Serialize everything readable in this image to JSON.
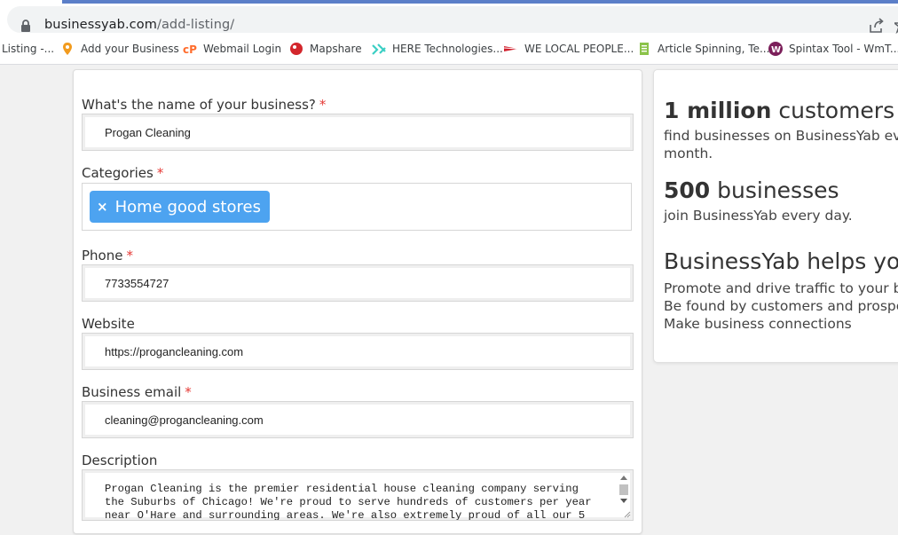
{
  "browser": {
    "url_domain": "businessyab.com",
    "url_path": "/add-listing/",
    "bookmarks": [
      {
        "label": "Listing -...",
        "icon": "none"
      },
      {
        "label": "Add your Business",
        "icon": "location-pin-icon"
      },
      {
        "label": "Webmail Login",
        "icon": "cpanel-icon"
      },
      {
        "label": "Mapshare",
        "icon": "mapshare-icon"
      },
      {
        "label": "HERE Technologies...",
        "icon": "here-icon"
      },
      {
        "label": "WE LOCAL PEOPLE...",
        "icon": "flag-icon"
      },
      {
        "label": "Article Spinning, Te...",
        "icon": "document-icon"
      },
      {
        "label": "Spintax Tool - WmT...",
        "icon": "spintax-icon"
      }
    ]
  },
  "form": {
    "name_label": "What's the name of your business?",
    "name_value": "Progan Cleaning",
    "categories_label": "Categories",
    "category_chip": "Home good stores",
    "category_remove": "×",
    "phone_label": "Phone",
    "phone_value": "7733554727",
    "website_label": "Website",
    "website_value": "https://progancleaning.com",
    "email_label": "Business email",
    "email_value": "cleaning@progancleaning.com",
    "description_label": "Description",
    "description_value": "Progan Cleaning is the premier residential house cleaning company serving\nthe Suburbs of Chicago! We're proud to serve hundreds of customers per year\nnear O'Hare and surrounding areas. We're also extremely proud of all our 5",
    "required_mark": "*"
  },
  "sidebar": {
    "stat1_number": "1 million",
    "stat1_unit": "customers",
    "stat1_desc_line1": "find businesses on BusinessYab every",
    "stat1_desc_line2": "month.",
    "stat2_number": "500",
    "stat2_unit": "businesses",
    "stat2_desc": "join BusinessYab every day.",
    "helps_title": "BusinessYab helps you.",
    "benefits": [
      "Promote and drive traffic to your business",
      "Be found by customers and prospects",
      "Make business connections"
    ]
  },
  "colors": {
    "chip": "#4da3f0",
    "required": "#e53935"
  }
}
